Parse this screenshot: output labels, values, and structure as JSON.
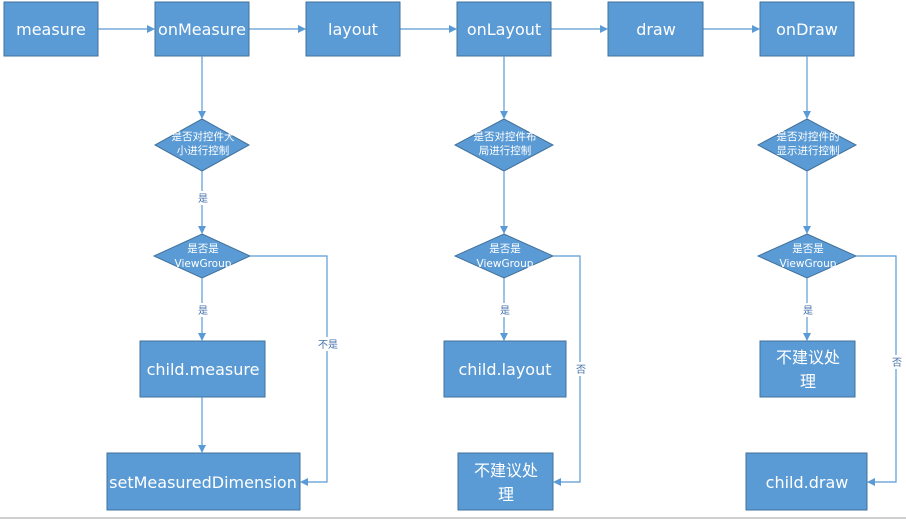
{
  "top_row": [
    "measure",
    "onMeasure",
    "layout",
    "onLayout",
    "draw",
    "onDraw"
  ],
  "measure_branch": {
    "decision1": [
      "是否对控件大",
      "小进行控制"
    ],
    "edge_yes1": "是",
    "decision2": [
      "是否是",
      "ViewGroup"
    ],
    "edge_yes2": "是",
    "edge_no": "不是",
    "box1": "child.measure",
    "box2": "setMeasuredDimension"
  },
  "layout_branch": {
    "decision1": [
      "是否对控件布",
      "局进行控制"
    ],
    "decision2": [
      "是否是",
      "ViewGroup"
    ],
    "edge_yes": "是",
    "edge_no": "否",
    "box1": "child.layout",
    "box2": [
      "不建议处",
      "理"
    ]
  },
  "draw_branch": {
    "decision1": [
      "是否对控件的",
      "显示进行控制"
    ],
    "decision2": [
      "是否是",
      "ViewGroup"
    ],
    "edge_yes": "是",
    "edge_no": "否",
    "box1": [
      "不建议处",
      "理"
    ],
    "box2": "child.draw"
  }
}
